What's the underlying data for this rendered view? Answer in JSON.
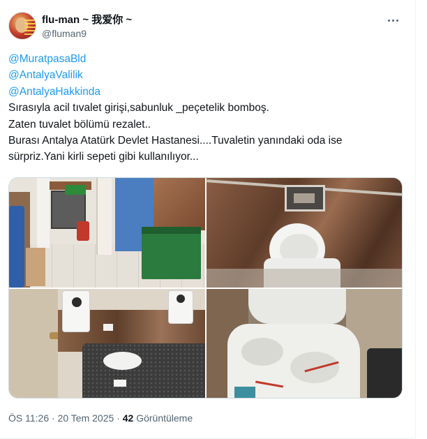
{
  "tweet": {
    "author": {
      "display_name": "flu-man ~ 我爱你 ~",
      "handle": "@fluman9"
    },
    "mentions": [
      "@MuratpasaBld",
      "@AntalyaValilik",
      "@AntalyaHakkinda"
    ],
    "text_lines": [
      "Sırasıyla acil tıvalet girişi,sabunluk _peçetelik bomboş.",
      "Zaten tuvalet bölümü rezalet..",
      "Burası Antalya Atatürk Devlet Hastanesi....Tuvaletin yanındaki oda ise",
      "sürpriz.Yani kirli sepeti gibi kullanılıyor..."
    ],
    "meta": {
      "time": "ÖS 11:26",
      "separator1": "·",
      "date": "20 Tem 2025",
      "separator2": "·",
      "views_count": "42",
      "views_label": "Görüntüleme"
    },
    "icons": {
      "more": "more-horizontal-icon"
    }
  },
  "colors": {
    "link": "#1d9bf0",
    "secondary_text": "#536471",
    "border": "#cfd9de"
  }
}
